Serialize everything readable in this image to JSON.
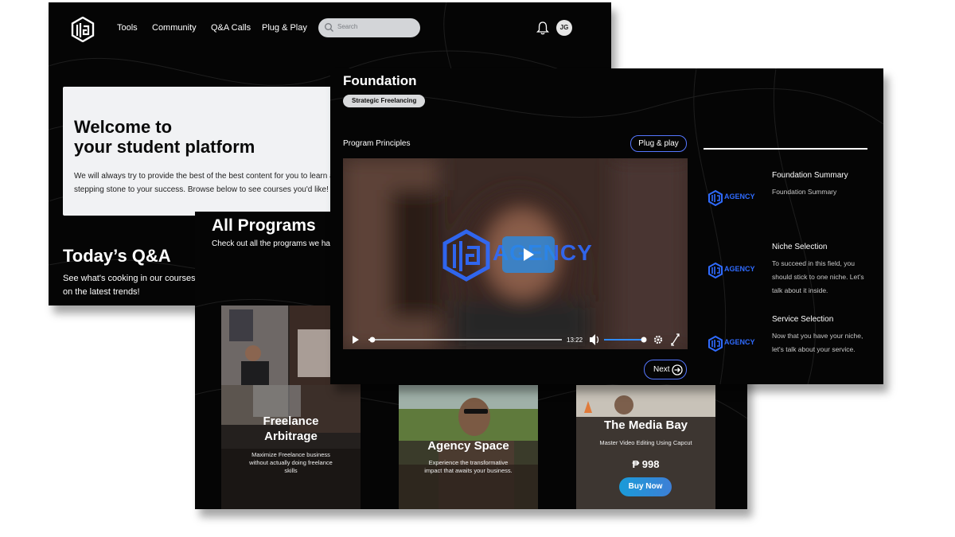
{
  "nav": {
    "links": [
      "Tools",
      "Community",
      "Q&A Calls",
      "Plug & Play"
    ],
    "search_placeholder": "Search",
    "avatar_initials": "JG"
  },
  "welcome": {
    "title_line1": "Welcome to",
    "title_line2": "your student platform",
    "body": "We will always try to provide the best of the best content for you to learn and be a stepping stone to your success. Browse below to see courses you'd like!"
  },
  "qa": {
    "title": "Today’s Q&A",
    "subtitle": "See what's cooking in our courses on the latest trends!"
  },
  "programs": {
    "title": "All Programs",
    "subtitle": "Check out all the programs we have",
    "cards": [
      {
        "title_line1": "Freelance",
        "title_line2": "Arbitrage",
        "desc": "Maximize Freelance business without actually doing freelance skills"
      },
      {
        "title": "Agency Space",
        "desc": "Experience the transformative impact that awaits your business."
      },
      {
        "title": "The Media Bay",
        "desc": "Master Video Editing Using Capcut",
        "price": "₱ 998",
        "cta": "Buy Now"
      }
    ]
  },
  "foundation": {
    "title": "Foundation",
    "badge": "Strategic Freelancing",
    "section_label": "Program Principles",
    "plug_button": "Plug & play",
    "video": {
      "timecode": "13:22",
      "progress": 0.02,
      "volume": 1.0,
      "overlay_logo_text": "AGENCY"
    },
    "next_button": "Next",
    "lessons": [
      {
        "title": "Foundation Summary",
        "desc": "Foundation Summary",
        "thumb_text": "AGENCY"
      },
      {
        "title": "Niche Selection",
        "desc": "To succeed in this field, you should stick to one niche. Let’s talk about it inside.",
        "thumb_text": "AGENCY"
      },
      {
        "title": "Service Selection",
        "desc": "Now that you have your niche, let's talk about your service.",
        "thumb_text": "AGENCY"
      }
    ]
  },
  "colors": {
    "accent": "#2f6bff",
    "panel": "#050505",
    "button_gradient_start": "#1a9bd8",
    "button_gradient_end": "#3d7fd6"
  }
}
